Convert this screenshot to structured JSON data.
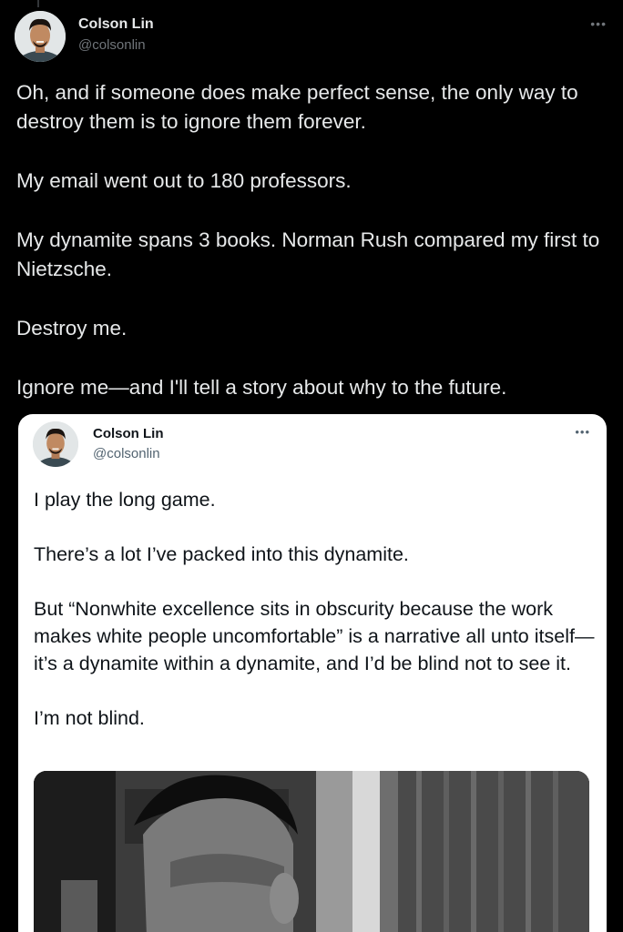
{
  "tweet": {
    "author_name": "Colson Lin",
    "author_handle": "@colsonlin",
    "more_icon": "more-icon",
    "paragraphs": [
      "Oh, and if someone does make perfect sense, the only way to destroy them is to ignore them forever.",
      "My email went out to 180 professors.",
      "My dynamite spans 3 books. Norman Rush compared my first to Nietzsche.",
      "Destroy me.",
      "Ignore me—and I'll tell a story about why to the future."
    ]
  },
  "quote": {
    "author_name": "Colson Lin",
    "author_handle": "@colsonlin",
    "more_icon": "more-icon",
    "paragraphs": [
      "I play the long game.",
      "There’s a lot I’ve packed into this dynamite.",
      "But “Nonwhite excellence sits in obscurity because the work makes white people uncomfortable” is a narrative all unto itself—it’s a dynamite within a dynamite, and I’d be blind not to see it.",
      "I’m not blind."
    ],
    "media_icon": "black-and-white-photo"
  },
  "colors": {
    "background": "#000000",
    "text_primary": "#e7e9ea",
    "text_secondary": "#71767b",
    "card_background": "#ffffff"
  }
}
